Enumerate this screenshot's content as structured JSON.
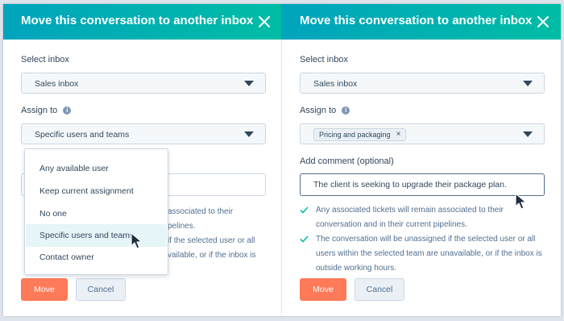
{
  "left": {
    "title": "Move this conversation to another inbox",
    "select_inbox_label": "Select inbox",
    "select_inbox_value": "Sales inbox",
    "assign_to_label": "Assign to",
    "assign_to_value": "Specific users and teams",
    "dropdown_options": [
      "Any available user",
      "Keep current assignment",
      "No one",
      "Specific users and teams",
      "Contact owner"
    ],
    "dropdown_selected": "Specific users and teams",
    "partial_text": [
      "associated to their",
      "pelines.",
      "if the selected user or all",
      "vailable, or if the inbox is"
    ],
    "move_label": "Move",
    "cancel_label": "Cancel"
  },
  "right": {
    "title": "Move this conversation to another inbox",
    "select_inbox_label": "Select inbox",
    "select_inbox_value": "Sales inbox",
    "assign_to_label": "Assign to",
    "tag_label": "Pricing and packaging",
    "comment_label": "Add comment (optional)",
    "comment_value": "The client is seeking to upgrade their package plan.",
    "notes": [
      "Any associated tickets will remain associated to their conversation and in their current pipelines.",
      "The conversation will be unassigned if the selected user or all users within the selected team are unavailable, or if the inbox is outside working hours."
    ],
    "move_label": "Move",
    "cancel_label": "Cancel"
  },
  "colors": {
    "header_start": "#00a4bd",
    "header_end": "#00bda5",
    "primary_button": "#ff7a59",
    "check": "#00bda5",
    "active_option_bg": "#e5f5f8"
  },
  "icons": {
    "close": "close-icon",
    "info": "info-icon",
    "caret": "caret-down-icon",
    "check": "checkmark-icon",
    "tag_remove": "remove-tag-icon",
    "cursor": "mouse-cursor-icon"
  }
}
